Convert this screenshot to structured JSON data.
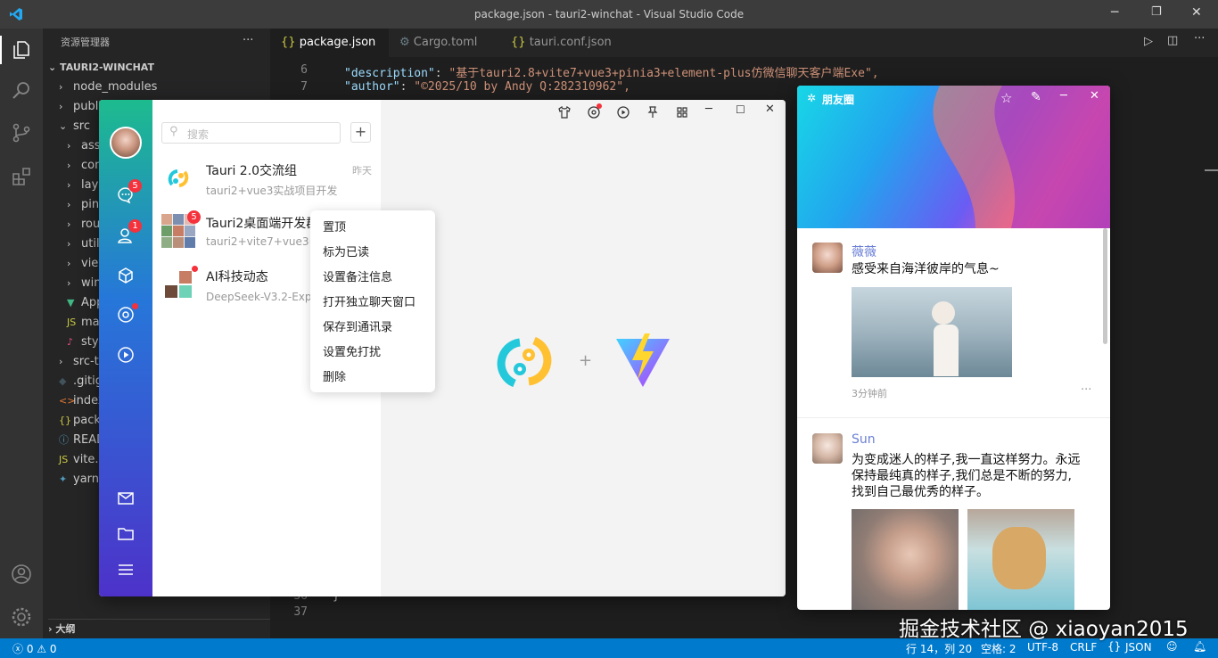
{
  "window": {
    "title": "package.json - tauri2-winchat - Visual Studio Code"
  },
  "sidebar": {
    "header": "资源管理器",
    "project": "TAURI2-WINCHAT",
    "items": [
      {
        "label": "node_modules",
        "icon": "chevron-right"
      },
      {
        "label": "publi",
        "icon": "chevron-right"
      },
      {
        "label": "src",
        "icon": "chevron-down"
      },
      {
        "label": "asse",
        "icon": "chevron-right"
      },
      {
        "label": "com",
        "icon": "chevron-right"
      },
      {
        "label": "layo",
        "icon": "chevron-right"
      },
      {
        "label": "pini",
        "icon": "chevron-right"
      },
      {
        "label": "rout",
        "icon": "chevron-right"
      },
      {
        "label": "utils",
        "icon": "chevron-right"
      },
      {
        "label": "view",
        "icon": "chevron-right"
      },
      {
        "label": "win",
        "icon": "chevron-right"
      },
      {
        "label": "App",
        "icon": "vue"
      },
      {
        "label": "mai",
        "icon": "js"
      },
      {
        "label": "style",
        "icon": "css"
      },
      {
        "label": "src-ta",
        "icon": "chevron-right"
      },
      {
        "label": ".gitig",
        "icon": "git"
      },
      {
        "label": "index",
        "icon": "html"
      },
      {
        "label": "packa",
        "icon": "json"
      },
      {
        "label": "READ",
        "icon": "info"
      },
      {
        "label": "vite.c",
        "icon": "js"
      },
      {
        "label": "yarn.l",
        "icon": "yarn"
      }
    ],
    "outline": "大纲"
  },
  "tabs": [
    {
      "label": "package.json",
      "icon": "{}",
      "active": true
    },
    {
      "label": "Cargo.toml",
      "icon": "gear",
      "active": false
    },
    {
      "label": "tauri.conf.json",
      "icon": "{}",
      "active": false
    }
  ],
  "editor": {
    "lines": [
      {
        "num": "6",
        "key": "\"description\"",
        "value": "\"基于tauri2.8+vite7+vue3+pinia3+element-plus仿微信聊天客户端Exe\","
      },
      {
        "num": "7",
        "key": "\"author\"",
        "value": "\"©2025/10 by Andy Q:282310962\","
      },
      {
        "num": "36",
        "key": "}",
        "value": ""
      },
      {
        "num": "37",
        "key": "",
        "value": ""
      }
    ]
  },
  "statusbar": {
    "errors": "0",
    "warnings": "0",
    "position": "行 14，列 20",
    "spaces": "空格: 2",
    "encoding": "UTF-8",
    "eol": "CRLF",
    "language": "JSON"
  },
  "chat": {
    "search_placeholder": "搜索",
    "nav_badges": {
      "chat": "5",
      "contacts": "1"
    },
    "items": [
      {
        "name": "Tauri 2.0交流组",
        "msg": "tauri2+vue3实战项目开发",
        "time": "昨天"
      },
      {
        "name": "Tauri2桌面端开发群",
        "msg": "tauri2+vite7+vue3+pinia",
        "time": "",
        "badge": "5"
      },
      {
        "name": "AI科技动态",
        "msg": "DeepSeek-V3.2-Exp模",
        "time": ""
      }
    ],
    "context_menu": [
      "置顶",
      "标为已读",
      "设置备注信息",
      "打开独立聊天窗口",
      "保存到通讯录",
      "设置免打扰",
      "删除"
    ],
    "plus": "+"
  },
  "moments": {
    "title": "朋友圈",
    "posts": [
      {
        "name": "薇薇",
        "text": "感受来自海洋彼岸的气息~",
        "time": "3分钟前"
      },
      {
        "name": "Sun",
        "text_lines": [
          "为变成迷人的样子,我一直这样努力。永远",
          "保持最纯真的样子,我们总是不断的努力,",
          "找到自己最优秀的样子。"
        ]
      }
    ],
    "more": "···"
  },
  "watermark": "掘金技术社区 @ xiaoyan2015",
  "colors": {
    "vscode_blue": "#007acc",
    "moments_name": "#6a7fd6",
    "badge_red": "#f5313c"
  }
}
